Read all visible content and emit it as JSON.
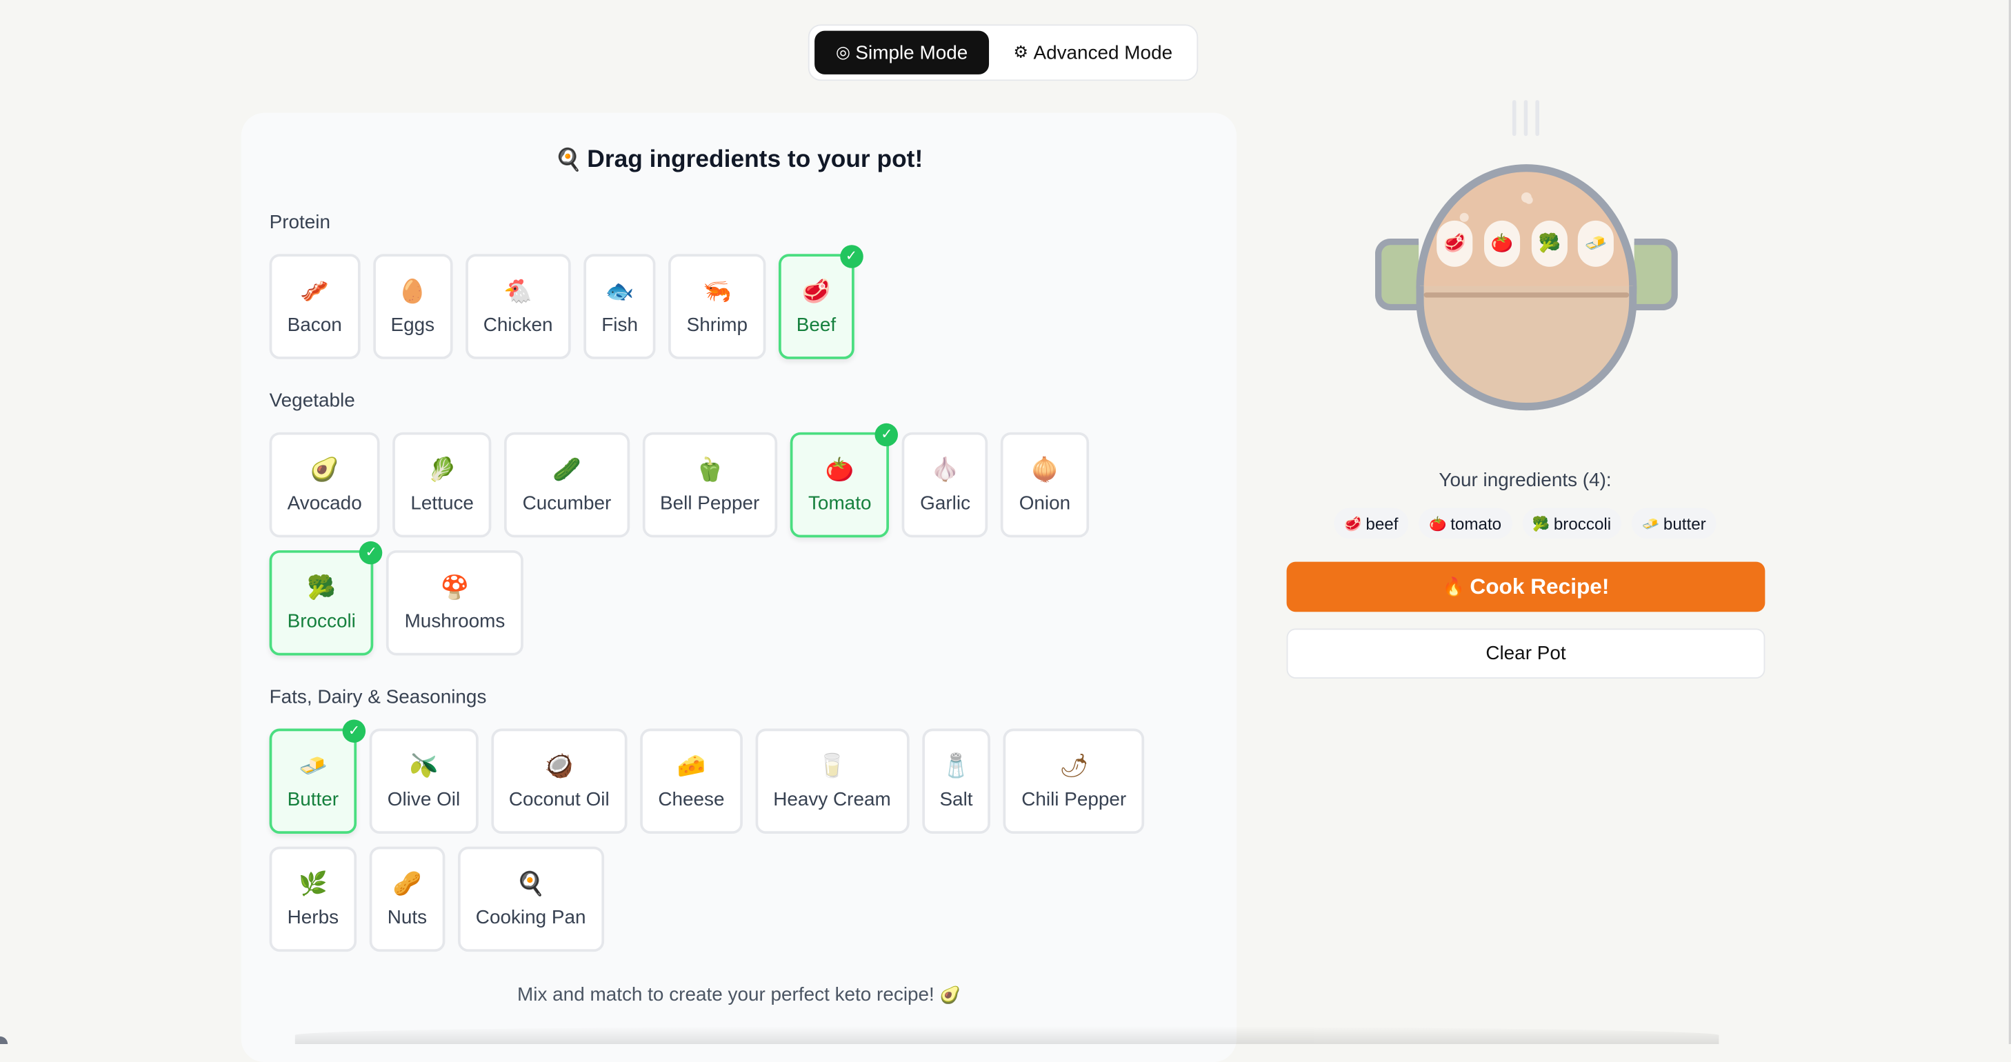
{
  "mode_toggle": {
    "simple": {
      "icon": "target-icon",
      "glyph": "◎",
      "label": "Simple Mode"
    },
    "advanced": {
      "icon": "gear-icon",
      "glyph": "⚙",
      "label": "Advanced Mode"
    }
  },
  "panel": {
    "title": "Drag ingredients to your pot!",
    "title_icon": "frying-pan-icon",
    "title_glyph": "🍳",
    "footer": "Mix and match to create your perfect keto recipe!",
    "footer_icon": "avocado-icon",
    "footer_glyph": "🥑"
  },
  "sections": {
    "protein": {
      "label": "Protein",
      "items": [
        {
          "label": "Bacon",
          "icon": "bacon-icon",
          "glyph": "🥓",
          "selected": false
        },
        {
          "label": "Eggs",
          "icon": "egg-icon",
          "glyph": "🥚",
          "selected": false
        },
        {
          "label": "Chicken",
          "icon": "chicken-icon",
          "glyph": "🐔",
          "selected": false
        },
        {
          "label": "Fish",
          "icon": "fish-icon",
          "glyph": "🐟",
          "selected": false
        },
        {
          "label": "Shrimp",
          "icon": "shrimp-icon",
          "glyph": "🦐",
          "selected": false
        },
        {
          "label": "Beef",
          "icon": "beef-icon",
          "glyph": "🥩",
          "selected": true
        }
      ]
    },
    "vegetable": {
      "label": "Vegetable",
      "items": [
        {
          "label": "Avocado",
          "icon": "avocado-icon",
          "glyph": "🥑",
          "selected": false
        },
        {
          "label": "Lettuce",
          "icon": "lettuce-icon",
          "glyph": "🥬",
          "selected": false
        },
        {
          "label": "Cucumber",
          "icon": "cucumber-icon",
          "glyph": "🥒",
          "selected": false
        },
        {
          "label": "Bell Pepper",
          "icon": "bell-pepper-icon",
          "glyph": "🫑",
          "selected": false
        },
        {
          "label": "Tomato",
          "icon": "tomato-icon",
          "glyph": "🍅",
          "selected": true
        },
        {
          "label": "Garlic",
          "icon": "garlic-icon",
          "glyph": "🧄",
          "selected": false
        },
        {
          "label": "Onion",
          "icon": "onion-icon",
          "glyph": "🧅",
          "selected": false
        },
        {
          "label": "Broccoli",
          "icon": "broccoli-icon",
          "glyph": "🥦",
          "selected": true
        },
        {
          "label": "Mushrooms",
          "icon": "mushroom-icon",
          "glyph": "🍄",
          "selected": false
        }
      ]
    },
    "fats": {
      "label": "Fats, Dairy & Seasonings",
      "items": [
        {
          "label": "Butter",
          "icon": "butter-icon",
          "glyph": "🧈",
          "selected": true
        },
        {
          "label": "Olive Oil",
          "icon": "olive-icon",
          "glyph": "🫒",
          "selected": false
        },
        {
          "label": "Coconut Oil",
          "icon": "coconut-icon",
          "glyph": "🥥",
          "selected": false
        },
        {
          "label": "Cheese",
          "icon": "cheese-icon",
          "glyph": "🧀",
          "selected": false
        },
        {
          "label": "Heavy Cream",
          "icon": "glass-of-milk-icon",
          "glyph": "🥛",
          "selected": false
        },
        {
          "label": "Salt",
          "icon": "salt-shaker-icon",
          "glyph": "🧂",
          "selected": false
        },
        {
          "label": "Chili Pepper",
          "icon": "chili-pepper-icon",
          "glyph": "🌶",
          "selected": false
        },
        {
          "label": "Herbs",
          "icon": "herb-icon",
          "glyph": "🌿",
          "selected": false
        },
        {
          "label": "Nuts",
          "icon": "peanut-icon",
          "glyph": "🥜",
          "selected": false
        },
        {
          "label": "Cooking Pan",
          "icon": "frying-pan-icon",
          "glyph": "🍳",
          "selected": false
        }
      ]
    }
  },
  "pot": {
    "items": [
      {
        "icon": "beef-icon",
        "glyph": "🥩"
      },
      {
        "icon": "tomato-icon",
        "glyph": "🍅"
      },
      {
        "icon": "broccoli-icon",
        "glyph": "🥦"
      },
      {
        "icon": "butter-icon",
        "glyph": "🧈"
      }
    ]
  },
  "right": {
    "ingredients_title": "Your ingredients (4):",
    "chips": [
      {
        "label": "beef",
        "icon": "beef-icon",
        "glyph": "🥩"
      },
      {
        "label": "tomato",
        "icon": "tomato-icon",
        "glyph": "🍅"
      },
      {
        "label": "broccoli",
        "icon": "broccoli-icon",
        "glyph": "🥦"
      },
      {
        "label": "butter",
        "icon": "butter-icon",
        "glyph": "🧈"
      }
    ],
    "cook_label": "Cook Recipe!",
    "cook_icon": "fire-icon",
    "cook_glyph": "🔥",
    "clear_label": "Clear Pot"
  },
  "colors": {
    "accent_orange": "#f07318",
    "selected_green": "#22c55e",
    "toggle_active": "#111111"
  }
}
